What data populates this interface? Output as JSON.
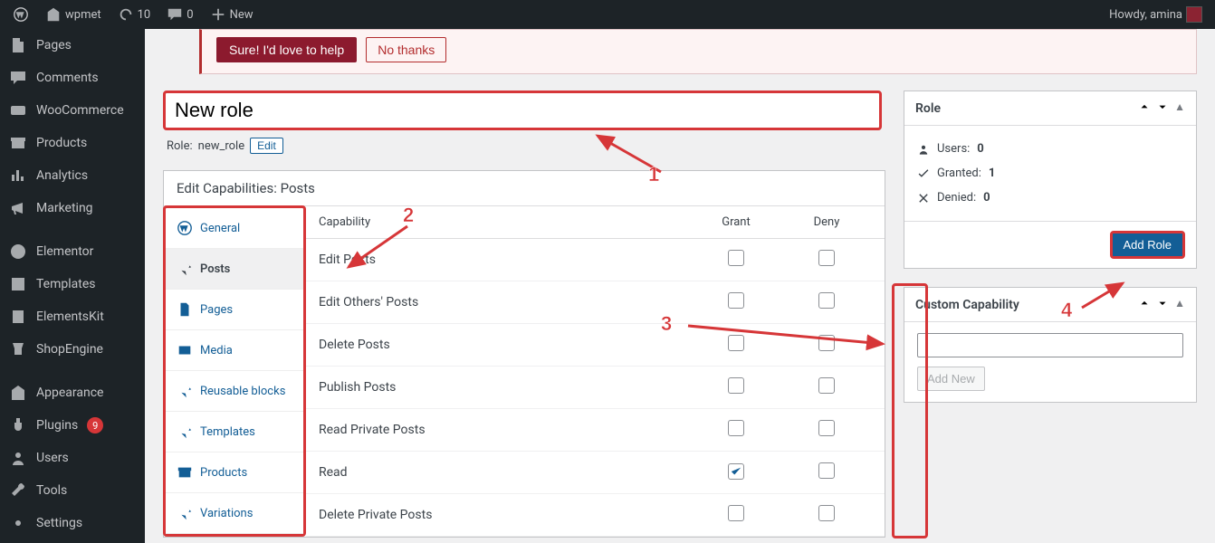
{
  "adminbar": {
    "site_name": "wpmet",
    "updates": "10",
    "comments": "0",
    "new_label": "New",
    "howdy": "Howdy, amina"
  },
  "sidebar": {
    "items": [
      {
        "label": "Pages",
        "icon": "page"
      },
      {
        "label": "Comments",
        "icon": "comment"
      },
      {
        "label": "WooCommerce",
        "icon": "woo"
      },
      {
        "label": "Products",
        "icon": "archive"
      },
      {
        "label": "Analytics",
        "icon": "chart"
      },
      {
        "label": "Marketing",
        "icon": "megaphone"
      },
      {
        "label": "Elementor",
        "icon": "elementor"
      },
      {
        "label": "Templates",
        "icon": "templates"
      },
      {
        "label": "ElementsKit",
        "icon": "ekit"
      },
      {
        "label": "ShopEngine",
        "icon": "shopengine"
      },
      {
        "label": "Appearance",
        "icon": "appearance"
      },
      {
        "label": "Plugins",
        "icon": "plugin",
        "badge": "9"
      },
      {
        "label": "Users",
        "icon": "user"
      },
      {
        "label": "Tools",
        "icon": "tools"
      },
      {
        "label": "Settings",
        "icon": "settings"
      }
    ]
  },
  "banner": {
    "primary": "Sure! I'd love to help",
    "secondary": "No thanks"
  },
  "title": {
    "value": "New role",
    "slug_label": "Role:",
    "slug": "new_role",
    "edit": "Edit"
  },
  "cap_panel": {
    "heading": "Edit Capabilities: Posts",
    "col_capability": "Capability",
    "col_grant": "Grant",
    "col_deny": "Deny",
    "tabs": [
      {
        "label": "General",
        "icon": "wp"
      },
      {
        "label": "Posts",
        "icon": "pin",
        "active": true
      },
      {
        "label": "Pages",
        "icon": "page2"
      },
      {
        "label": "Media",
        "icon": "media"
      },
      {
        "label": "Reusable blocks",
        "icon": "pin"
      },
      {
        "label": "Templates",
        "icon": "pin"
      },
      {
        "label": "Products",
        "icon": "archive2"
      },
      {
        "label": "Variations",
        "icon": "pin"
      }
    ],
    "rows": [
      {
        "name": "Edit Posts",
        "grant": false,
        "deny": false
      },
      {
        "name": "Edit Others' Posts",
        "grant": false,
        "deny": false
      },
      {
        "name": "Delete Posts",
        "grant": false,
        "deny": false
      },
      {
        "name": "Publish Posts",
        "grant": false,
        "deny": false
      },
      {
        "name": "Read Private Posts",
        "grant": false,
        "deny": false
      },
      {
        "name": "Read",
        "grant": true,
        "deny": false
      },
      {
        "name": "Delete Private Posts",
        "grant": false,
        "deny": false
      }
    ]
  },
  "role_box": {
    "title": "Role",
    "users_label": "Users:",
    "users": "0",
    "granted_label": "Granted:",
    "granted": "1",
    "denied_label": "Denied:",
    "denied": "0",
    "button": "Add Role"
  },
  "custom_box": {
    "title": "Custom Capability",
    "button": "Add New"
  },
  "annotations": {
    "a1": "1",
    "a2": "2",
    "a3": "3",
    "a4": "4"
  }
}
